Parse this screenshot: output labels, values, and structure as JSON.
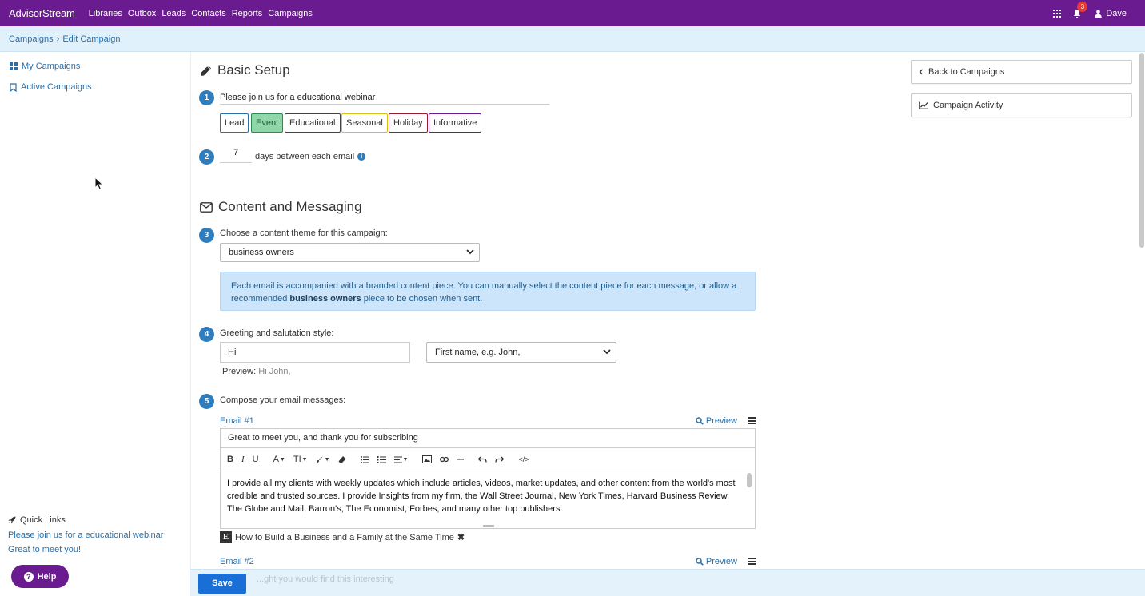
{
  "nav": {
    "brand": "AdvisorStream",
    "links": [
      "Libraries",
      "Outbox",
      "Leads",
      "Contacts",
      "Reports",
      "Campaigns"
    ],
    "notification_count": "3",
    "user": "Dave"
  },
  "breadcrumb": {
    "parent": "Campaigns",
    "separator": "›",
    "current": "Edit Campaign"
  },
  "sidebar": {
    "items": [
      {
        "label": "My Campaigns",
        "icon": "dashboard-icon"
      },
      {
        "label": "Active Campaigns",
        "icon": "bookmark-icon"
      }
    ],
    "quick_links_title": "Quick Links",
    "quick_links": [
      "Please join us for a educational webinar",
      "Great to meet you!"
    ],
    "help_label": "Help"
  },
  "basic_setup": {
    "title": "Basic Setup",
    "step1": "1",
    "campaign_name": "Please join us for a educational webinar",
    "tags": [
      {
        "label": "Lead",
        "color": "#2a6fa8",
        "selected": false
      },
      {
        "label": "Event",
        "color": "#2e8b57",
        "selected": true
      },
      {
        "label": "Educational",
        "color": "#444444",
        "selected": false
      },
      {
        "label": "Seasonal",
        "color": "#d4c414",
        "selected": false
      },
      {
        "label": "Holiday",
        "color": "#9b1b30",
        "selected": false
      },
      {
        "label": "Informative",
        "color": "#6a1b8f",
        "selected": false
      }
    ],
    "step2": "2",
    "days_value": "7",
    "days_label": "days between each email"
  },
  "content": {
    "title": "Content and Messaging",
    "step3": "3",
    "theme_label": "Choose a content theme for this campaign:",
    "theme_value": "business owners",
    "info_text_1": "Each email is accompanied with a branded content piece. You can manually select the content piece for each message, or allow a recommended ",
    "info_bold": "business owners",
    "info_text_2": " piece to be chosen when sent.",
    "step4": "4",
    "greeting_label": "Greeting and salutation style:",
    "greeting_value": "Hi",
    "salutation_value": "First name, e.g. John,",
    "preview_label": "Preview:",
    "preview_value": "Hi John,",
    "step5": "5",
    "compose_label": "Compose your email messages:"
  },
  "emails": [
    {
      "label": "Email #1",
      "preview": "Preview",
      "subject": "Great to meet you, and thank you for subscribing",
      "body": "I provide all my clients with weekly updates which include articles, videos, market updates, and other content from the world's most credible and trusted sources. I provide Insights from my firm, the Wall Street Journal, New York Times, Harvard Business Review, The Globe and Mail, Barron's, The Economist, Forbes, and many other top publishers.",
      "attachment": "How to Build a Business and a Family at the Same Time"
    },
    {
      "label": "Email #2",
      "preview": "Preview",
      "subject": "...ght you would find this interesting"
    }
  ],
  "toolbar": {
    "bold": "B",
    "italic": "I",
    "underline": "U",
    "font_color": "A",
    "font_size": "TI",
    "code": "</>"
  },
  "right_panel": {
    "back": "Back to Campaigns",
    "activity": "Campaign Activity"
  },
  "save_label": "Save",
  "colors": {
    "nav": "#6a1b8f",
    "accent": "#2e7dbe",
    "info_bg": "#cce5fb",
    "save": "#1a6fd6"
  }
}
